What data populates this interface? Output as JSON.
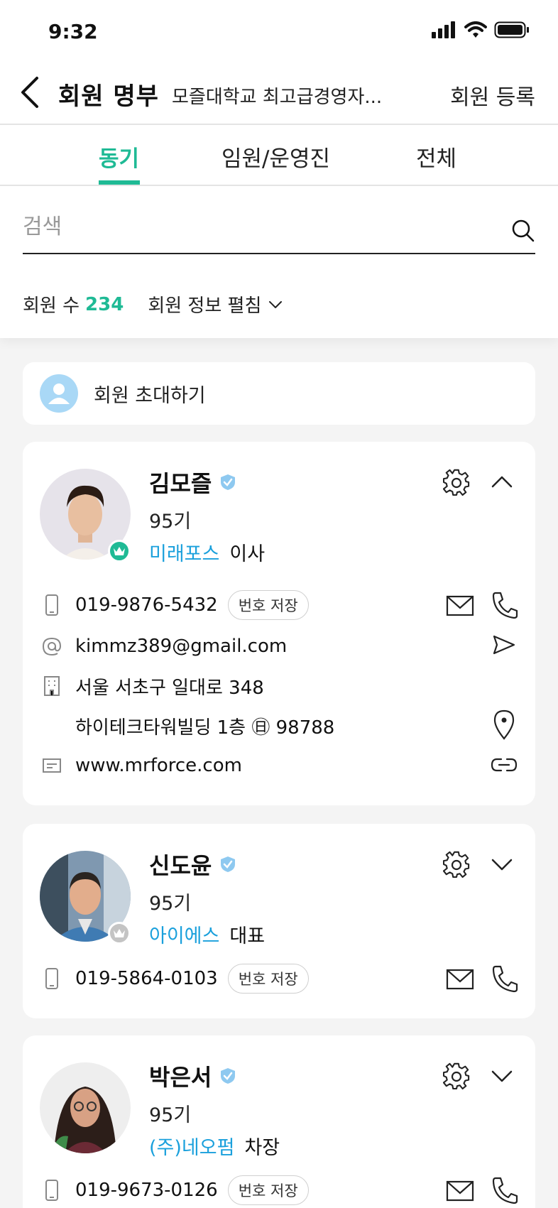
{
  "status_bar": {
    "time": "9:32"
  },
  "header": {
    "title": "회원 명부",
    "subtitle": "모즐대학교 최고급경영자...",
    "register_label": "회원 등록"
  },
  "tabs": [
    {
      "label": "동기",
      "active": true
    },
    {
      "label": "임원/운영진",
      "active": false
    },
    {
      "label": "전체",
      "active": false
    }
  ],
  "search": {
    "placeholder": "검색"
  },
  "summary": {
    "count_label": "회원 수",
    "count": "234",
    "expand_label": "회원 정보 펼침"
  },
  "invite": {
    "label": "회원 초대하기"
  },
  "members": [
    {
      "name": "김모즐",
      "generation": "95기",
      "company": "미래포스",
      "role": "이사",
      "phone": "019-9876-5432",
      "save_label": "번호 저장",
      "email": "kimmz389@gmail.com",
      "address_line1": "서울 서초구 일대로 348",
      "address_line2": "하이테크타워빌딩 1층 ㊐ 98788",
      "website": "www.mrforce.com",
      "expanded": true,
      "badge_color": "#1fba95"
    },
    {
      "name": "신도윤",
      "generation": "95기",
      "company": "아이에스",
      "role": "대표",
      "phone": "019-5864-0103",
      "save_label": "번호 저장",
      "expanded": false,
      "badge_color": "#c4c4c4"
    },
    {
      "name": "박은서",
      "generation": "95기",
      "company": "(주)네오펌",
      "role": "차장",
      "phone": "019-9673-0126",
      "save_label": "번호 저장",
      "expanded": false
    }
  ],
  "colors": {
    "accent": "#1fba95",
    "company_link": "#1aa0dc",
    "verified": "#8ec9f0"
  }
}
